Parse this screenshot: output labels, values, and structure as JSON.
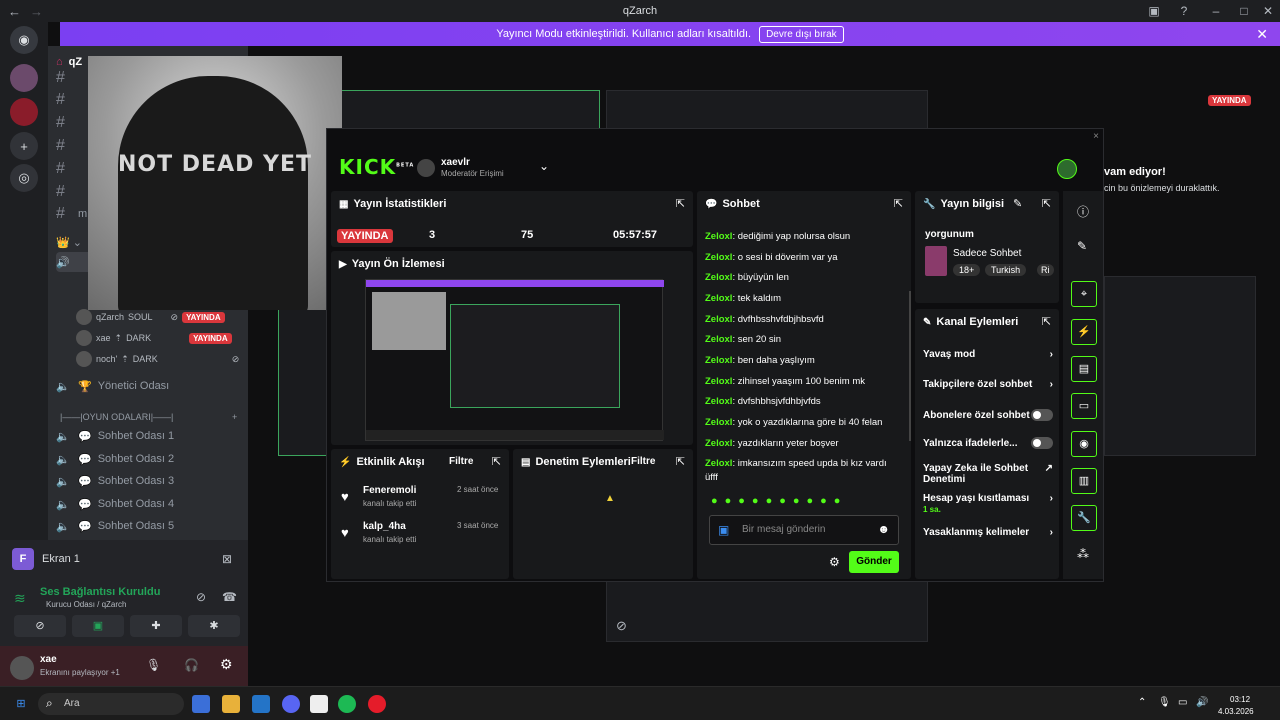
{
  "window": {
    "title": "qZarch",
    "back": "←",
    "forward": "→"
  },
  "banner": {
    "text": "Yayıncı Modu etkinleştirildi. Kullanıcı adları kısaltıldı.",
    "button": "Devre dışı bırak",
    "close": "✕"
  },
  "server_header": "qZ",
  "channels": {
    "text": [
      "#",
      "#",
      "#",
      "#",
      "#",
      "#"
    ],
    "muted_label": "m",
    "voice_users": [
      {
        "name": "qZarch",
        "tag": "SOUL",
        "badge": "YAYINDA"
      },
      {
        "name": "xae",
        "tag": "DARK",
        "badge": "YAYINDA"
      },
      {
        "name": "noch'",
        "tag": "DARK",
        "badge": ""
      }
    ],
    "admin_room": "Yönetici Odası",
    "games_header": "|——|OYUN ODALARI|——|",
    "rooms": [
      "Sohbet Odası 1",
      "Sohbet Odası 2",
      "Sohbet Odası 3",
      "Sohbet Odası 4",
      "Sohbet Odası 5"
    ]
  },
  "photo": {
    "text": "NOT DEAD YET"
  },
  "voice_panel": {
    "screen": "Ekran 1",
    "status": "Ses Bağlantısı Kuruldu",
    "location": "Kurucu Odası / qZarch",
    "user": "xae",
    "user_status": "Ekranını paylaşıyor +1"
  },
  "bg": {
    "live": "YAYINDA",
    "paused_title": "vam ediyor!",
    "paused_sub": "cin bu önizlemeyi duraklattık."
  },
  "kick": {
    "logo": "KICK",
    "beta": "BETA",
    "username": "xaevlr",
    "role": "Moderatör Erişimi",
    "close": "×",
    "stats": {
      "title": "Yayın İstatistikleri",
      "live": "YAYINDA",
      "viewers": "3",
      "followers": "75",
      "time": "05:57:57"
    },
    "preview": {
      "title": "Yayın Ön İzlemesi"
    },
    "activity": {
      "title": "Etkinlik Akışı",
      "filter": "Filtre",
      "items": [
        {
          "user": "Feneremoli",
          "action": "kanalı takip etti",
          "time": "2 saat önce"
        },
        {
          "user": "kalp_4ha",
          "action": "kanalı takip etti",
          "time": "3 saat önce"
        }
      ]
    },
    "moderation": {
      "title": "Denetim Eylemleri",
      "filter": "Filtre"
    },
    "chat": {
      "title": "Sohbet",
      "lines": [
        {
          "user": "Zeloxl",
          "msg": "dediğimi yap nolursa olsun"
        },
        {
          "user": "Zeloxl",
          "msg": "o sesi bi döverim var ya"
        },
        {
          "user": "Zeloxl",
          "msg": "büyüyün len"
        },
        {
          "user": "Zeloxl",
          "msg": "tek kaldım"
        },
        {
          "user": "Zeloxl",
          "msg": "dvfhbsshvfdbjhbsvfd"
        },
        {
          "user": "Zeloxl",
          "msg": "sen 20 sin"
        },
        {
          "user": "Zeloxl",
          "msg": "ben daha yaşlıyım"
        },
        {
          "user": "Zeloxl",
          "msg": "zihinsel yaaşım 100 benim mk"
        },
        {
          "user": "Zeloxl",
          "msg": "dvfshbhsjvfdhbjvfds"
        },
        {
          "user": "Zeloxl",
          "msg": "yok o yazdıklarına göre bi 40 felan"
        },
        {
          "user": "Zeloxl",
          "msg": "yazdıkların yeter boşver"
        },
        {
          "user": "Zeloxl",
          "msg": "imkansızım speed upda bi kız vardı"
        }
      ],
      "last_wrap": "üfff",
      "placeholder": "Bir mesaj gönderin",
      "send": "Gönder"
    },
    "info": {
      "title": "Yayın bilgisi",
      "stream_title": "yorgunum",
      "category": "Sadece Sohbet",
      "tags": [
        "18+",
        "Turkish",
        "Ri"
      ]
    },
    "actions": {
      "title": "Kanal Eylemleri",
      "items": [
        {
          "label": "Yavaş mod",
          "kind": "arrow"
        },
        {
          "label": "Takipçilere özel sohbet",
          "kind": "arrow"
        },
        {
          "label": "Abonelere özel sohbet",
          "kind": "toggle"
        },
        {
          "label": "Yalnızca ifadelerle...",
          "kind": "toggle"
        },
        {
          "label": "Yapay Zeka ile Sohbet Denetimi",
          "kind": "link"
        },
        {
          "label": "Hesap yaşı kısıtlaması",
          "kind": "arrow",
          "sub": "1 sa."
        },
        {
          "label": "Yasaklanmış kelimeler",
          "kind": "arrow"
        }
      ]
    }
  },
  "taskbar": {
    "search": "Ara",
    "time": "03:12",
    "date": "4.03.2026"
  },
  "colors": {
    "kick_green": "#53fc18",
    "live_red": "#da373c",
    "banner_purple": "#8f46ee"
  }
}
